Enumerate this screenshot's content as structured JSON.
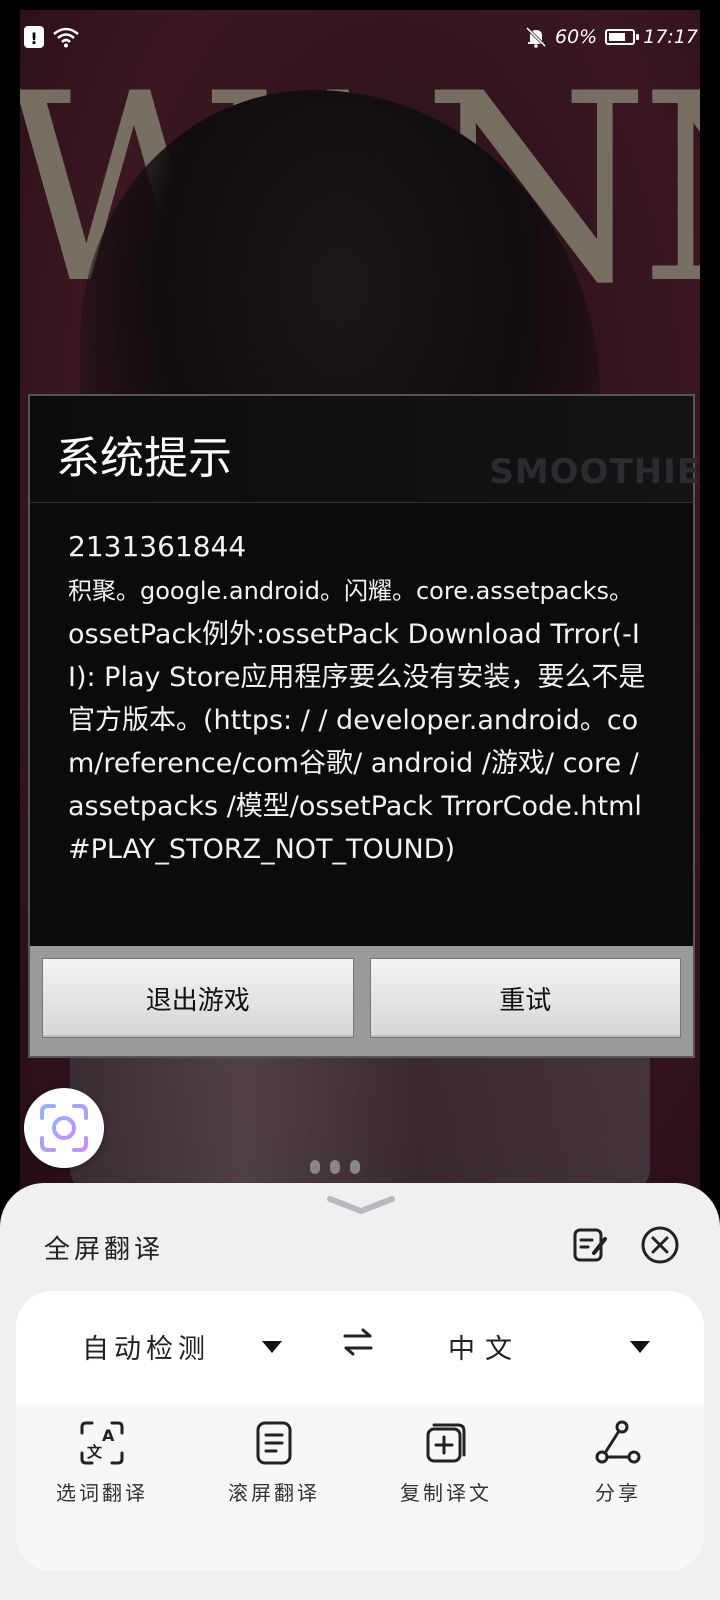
{
  "status_bar": {
    "battery_pct": "60%",
    "time": "17:17"
  },
  "background": {
    "logo_text": "WANNA",
    "watermark": "SMOOTHIE"
  },
  "dialog": {
    "title": "系统提示",
    "error_code": "2131361844",
    "line1": "积聚。google.android。闪耀。core.assetpacks。",
    "message": "ossetPack例外:ossetPack Download Trror(-II): Play Store应用程序要么没有安装，要么不是官方版本。(https: / / developer.android。com/reference/com谷歌/ android /游戏/ core / assetpacks /模型/ossetPack TrrorCode.html#PLAY_STORZ_NOT_TOUND)",
    "exit_label": "退出游戏",
    "retry_label": "重试"
  },
  "translate_sheet": {
    "title": "全屏翻译",
    "source_lang": "自动检测",
    "target_lang": "中文",
    "tools": [
      {
        "label": "选词翻译",
        "icon": "select-translate-icon"
      },
      {
        "label": "滚屏翻译",
        "icon": "scroll-translate-icon"
      },
      {
        "label": "复制译文",
        "icon": "copy-translation-icon"
      },
      {
        "label": "分享",
        "icon": "share-icon"
      }
    ]
  }
}
